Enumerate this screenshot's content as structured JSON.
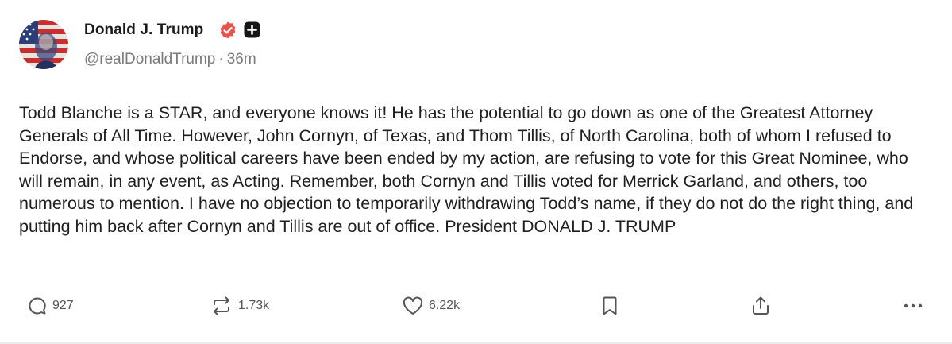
{
  "post": {
    "author": {
      "display_name": "Donald J. Trump",
      "handle": "@realDonaldTrump",
      "separator": "·",
      "timestamp": "36m",
      "verified_icon": "verified-badge-icon",
      "plus_icon": "plus-badge-icon",
      "verified_color": "#e8534a"
    },
    "text": "Todd Blanche is a STAR, and everyone knows it! He has the potential to go down as one of the Greatest Attorney Generals of All Time. However, John Cornyn, of Texas, and Thom Tillis, of North Carolina, both of whom I refused to Endorse, and whose political careers have been ended by my action, are refusing to vote for this Great Nominee, who will remain, in any event, as Acting. Remember, both Cornyn and Tillis voted for Merrick Garland, and others, too numerous to mention. I have no objection to temporarily withdrawing Todd’s name, if they do not do the right thing, and putting him back after Cornyn and Tillis are out of office. President DONALD J. TRUMP",
    "actions": {
      "replies": {
        "icon": "reply-icon",
        "count": "927"
      },
      "reposts": {
        "icon": "repost-icon",
        "count": "1.73k"
      },
      "likes": {
        "icon": "heart-icon",
        "count": "6.22k"
      },
      "bookmark": {
        "icon": "bookmark-icon"
      },
      "share": {
        "icon": "share-icon"
      },
      "more": {
        "icon": "more-icon"
      }
    }
  }
}
